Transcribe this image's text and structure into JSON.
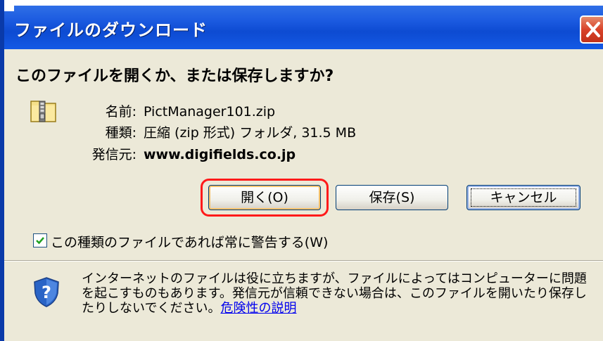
{
  "window": {
    "title": "ファイルのダウンロード",
    "close_icon": "close-icon"
  },
  "dialog": {
    "question": "このファイルを開くか、または保存しますか?",
    "file_icon": "zip-folder-icon",
    "name_label": "名前:",
    "name_value": "PictManager101.zip",
    "type_label": "種類:",
    "type_value": "圧縮 (zip 形式) フォルダ, 31.5 MB",
    "from_label": "発信元:",
    "from_value": "www.digifields.co.jp"
  },
  "buttons": {
    "open_label": "開く(O)",
    "save_label": "保存(S)",
    "cancel_label": "キャンセル"
  },
  "checkbox": {
    "checked": true,
    "label": "この種類のファイルであれば常に警告する(W)"
  },
  "warning": {
    "icon": "shield-question-icon",
    "text": "インターネットのファイルは役に立ちますが、ファイルによってはコンピューターに問題を起こすものもあります。発信元が信頼できない場合は、このファイルを開いたり保存したりしないでください。",
    "link_label": "危険性の説明"
  },
  "colors": {
    "titlebar": "#0d4bd2",
    "dialog_bg": "#ece9d8",
    "highlight": "#ff1a1a",
    "link": "#0000ee"
  }
}
